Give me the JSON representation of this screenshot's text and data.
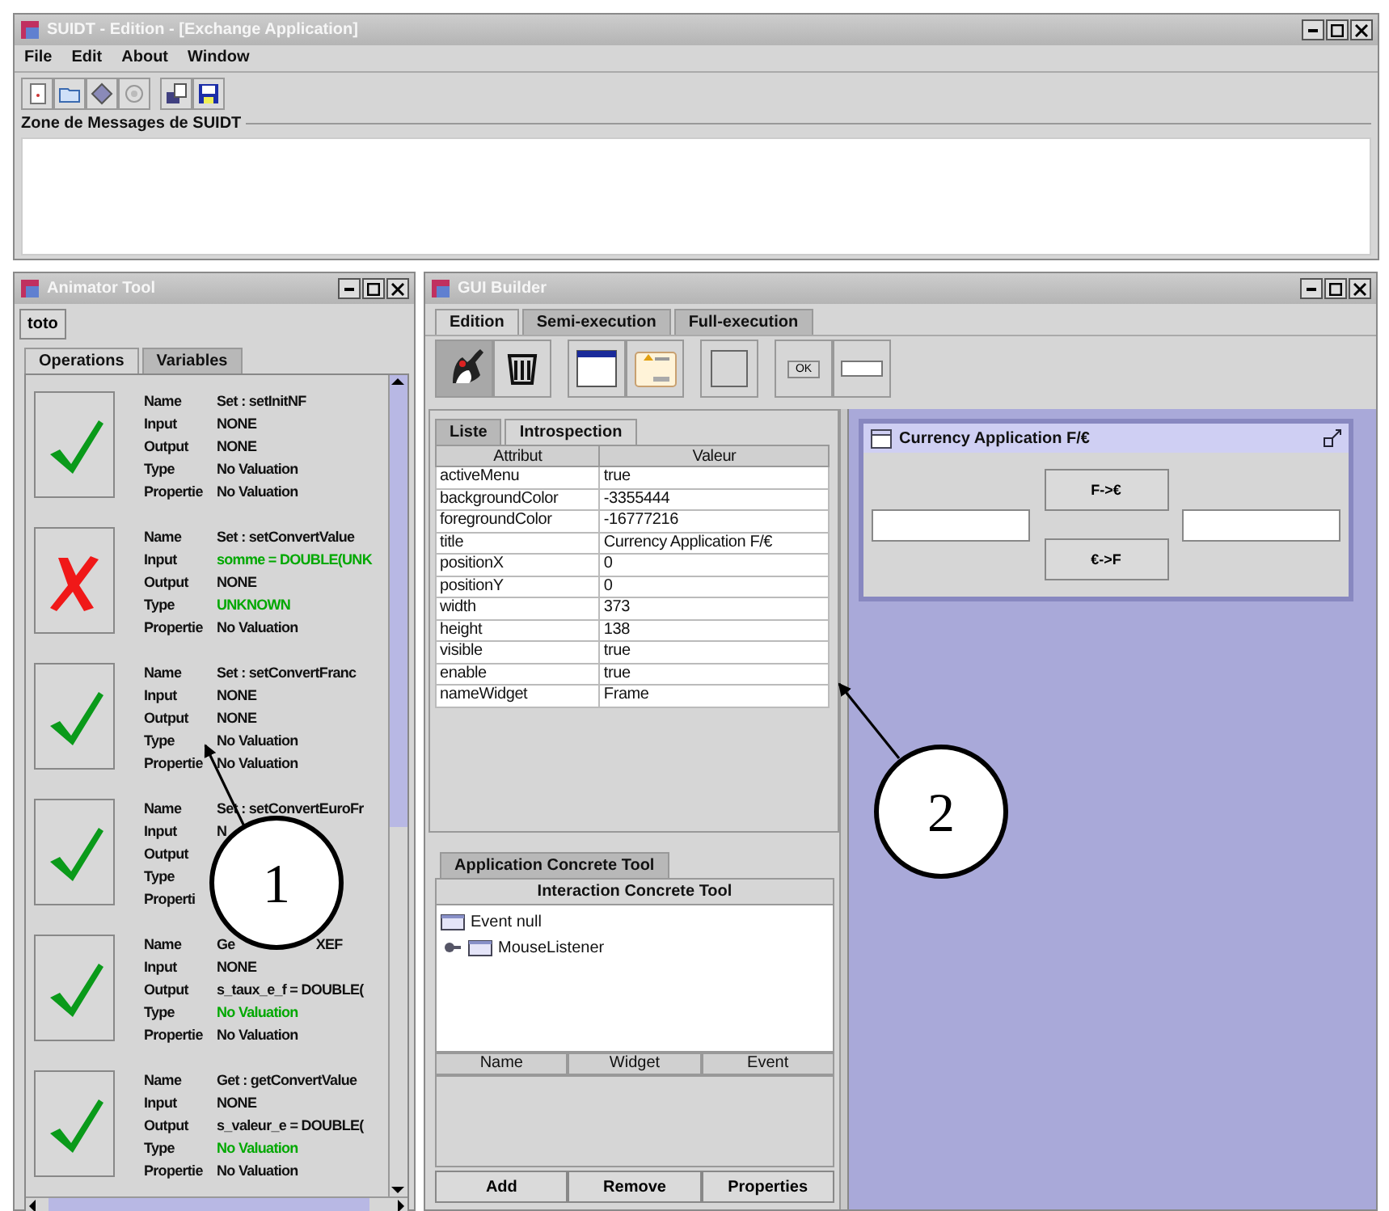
{
  "main_window": {
    "title": "SUIDT - Edition - [Exchange Application]",
    "menu": [
      "File",
      "Edit",
      "About",
      "Window"
    ],
    "message_zone": {
      "title": "Zone de Messages de SUIDT"
    }
  },
  "animator": {
    "title": "Animator Tool",
    "button": "toto",
    "tabs": [
      {
        "label": "Operations",
        "selected": true
      },
      {
        "label": "Variables",
        "selected": false
      }
    ],
    "operations": [
      {
        "passed": true,
        "fields": [
          {
            "label": "Name",
            "value": "Set : setInitNF",
            "highlighted": false
          },
          {
            "label": "Input",
            "value": "NONE",
            "highlighted": false
          },
          {
            "label": "Output",
            "value": "NONE",
            "highlighted": false
          },
          {
            "label": "Type",
            "value": "No Valuation",
            "highlighted": false
          },
          {
            "label": "Propertie",
            "value": "No Valuation",
            "highlighted": false
          }
        ]
      },
      {
        "passed": false,
        "fields": [
          {
            "label": "Name",
            "value": "Set : setConvertValue",
            "highlighted": false
          },
          {
            "label": "Input",
            "value": "somme = DOUBLE(UNK",
            "highlighted": true
          },
          {
            "label": "Output",
            "value": "NONE",
            "highlighted": false
          },
          {
            "label": "Type",
            "value": "UNKNOWN",
            "highlighted": true
          },
          {
            "label": "Propertie",
            "value": "No Valuation",
            "highlighted": false
          }
        ]
      },
      {
        "passed": true,
        "fields": [
          {
            "label": "Name",
            "value": "Set : setConvertFranc",
            "highlighted": false
          },
          {
            "label": "Input",
            "value": "NONE",
            "highlighted": false
          },
          {
            "label": "Output",
            "value": "NONE",
            "highlighted": false
          },
          {
            "label": "Type",
            "value": "No Valuation",
            "highlighted": false
          },
          {
            "label": "Propertie",
            "value": "No Valuation",
            "highlighted": false
          }
        ]
      },
      {
        "passed": true,
        "fields": [
          {
            "label": "Name",
            "value": "Set : setConvertEuroFr",
            "highlighted": false
          },
          {
            "label": "Input",
            "value": "N",
            "highlighted": false
          },
          {
            "label": "Output"
          },
          {
            "label": "Type"
          },
          {
            "label": "Properti"
          }
        ]
      },
      {
        "passed": true,
        "fields": [
          {
            "label": "Name",
            "value": "Ge",
            "value_tail": "XEF",
            "highlighted": false
          },
          {
            "label": "Input",
            "value": "NONE",
            "highlighted": false
          },
          {
            "label": "Output",
            "value": "s_taux_e_f = DOUBLE(",
            "highlighted": false
          },
          {
            "label": "Type",
            "value": "No Valuation",
            "highlighted": true
          },
          {
            "label": "Propertie",
            "value": "No Valuation",
            "highlighted": false
          }
        ]
      },
      {
        "passed": true,
        "fields": [
          {
            "label": "Name",
            "value": "Get : getConvertValue",
            "highlighted": false
          },
          {
            "label": "Input",
            "value": "NONE",
            "highlighted": false
          },
          {
            "label": "Output",
            "value": "s_valeur_e = DOUBLE(",
            "highlighted": false
          },
          {
            "label": "Type",
            "value": "No Valuation",
            "highlighted": true
          },
          {
            "label": "Propertie",
            "value": "No Valuation",
            "highlighted": false
          }
        ]
      }
    ]
  },
  "gui_builder": {
    "title": "GUI Builder",
    "tabs": [
      {
        "label": "Edition",
        "selected": true
      },
      {
        "label": "Semi-execution",
        "selected": false
      },
      {
        "label": "Full-execution",
        "selected": false
      }
    ],
    "tool_groups": [
      [
        {
          "kind": "pointer",
          "selected": true
        },
        {
          "kind": "trash",
          "selected": false
        }
      ],
      [
        {
          "kind": "frame",
          "selected": false
        },
        {
          "kind": "dialog",
          "selected": false
        }
      ],
      [
        {
          "kind": "panel",
          "selected": false
        }
      ],
      [
        {
          "kind": "button",
          "label": "OK",
          "selected": false
        },
        {
          "kind": "textfield",
          "selected": false
        }
      ]
    ],
    "inspector_tabs": [
      {
        "label": "Liste",
        "selected": false
      },
      {
        "label": "Introspection",
        "selected": true
      }
    ],
    "properties": {
      "columns": [
        "Attribut",
        "Valeur"
      ],
      "rows": [
        [
          "activeMenu",
          "true"
        ],
        [
          "backgroundColor",
          "-3355444"
        ],
        [
          "foregroundColor",
          "-16777216"
        ],
        [
          "title",
          "Currency Application F/€"
        ],
        [
          "positionX",
          "0"
        ],
        [
          "positionY",
          "0"
        ],
        [
          "width",
          "373"
        ],
        [
          "height",
          "138"
        ],
        [
          "visible",
          "true"
        ],
        [
          "enable",
          "true"
        ],
        [
          "nameWidget",
          "Frame"
        ]
      ]
    },
    "concrete_tabs": [
      {
        "label": "Application Concrete Tool",
        "selected": false
      },
      {
        "label": "Interaction Concrete Tool",
        "selected": true
      }
    ],
    "event_tree": [
      {
        "label": "Event null",
        "children": [
          {
            "label": "MouseListener",
            "expanded": false
          }
        ]
      }
    ],
    "events_table": {
      "columns": [
        "Name",
        "Widget",
        "Event"
      ]
    },
    "buttons": [
      "Add",
      "Remove",
      "Properties"
    ],
    "preview_window": {
      "title": "Currency Application F/€",
      "buttons": [
        "F->€",
        "€->F"
      ]
    }
  },
  "callouts": [
    {
      "label": "1"
    },
    {
      "label": "2"
    }
  ]
}
